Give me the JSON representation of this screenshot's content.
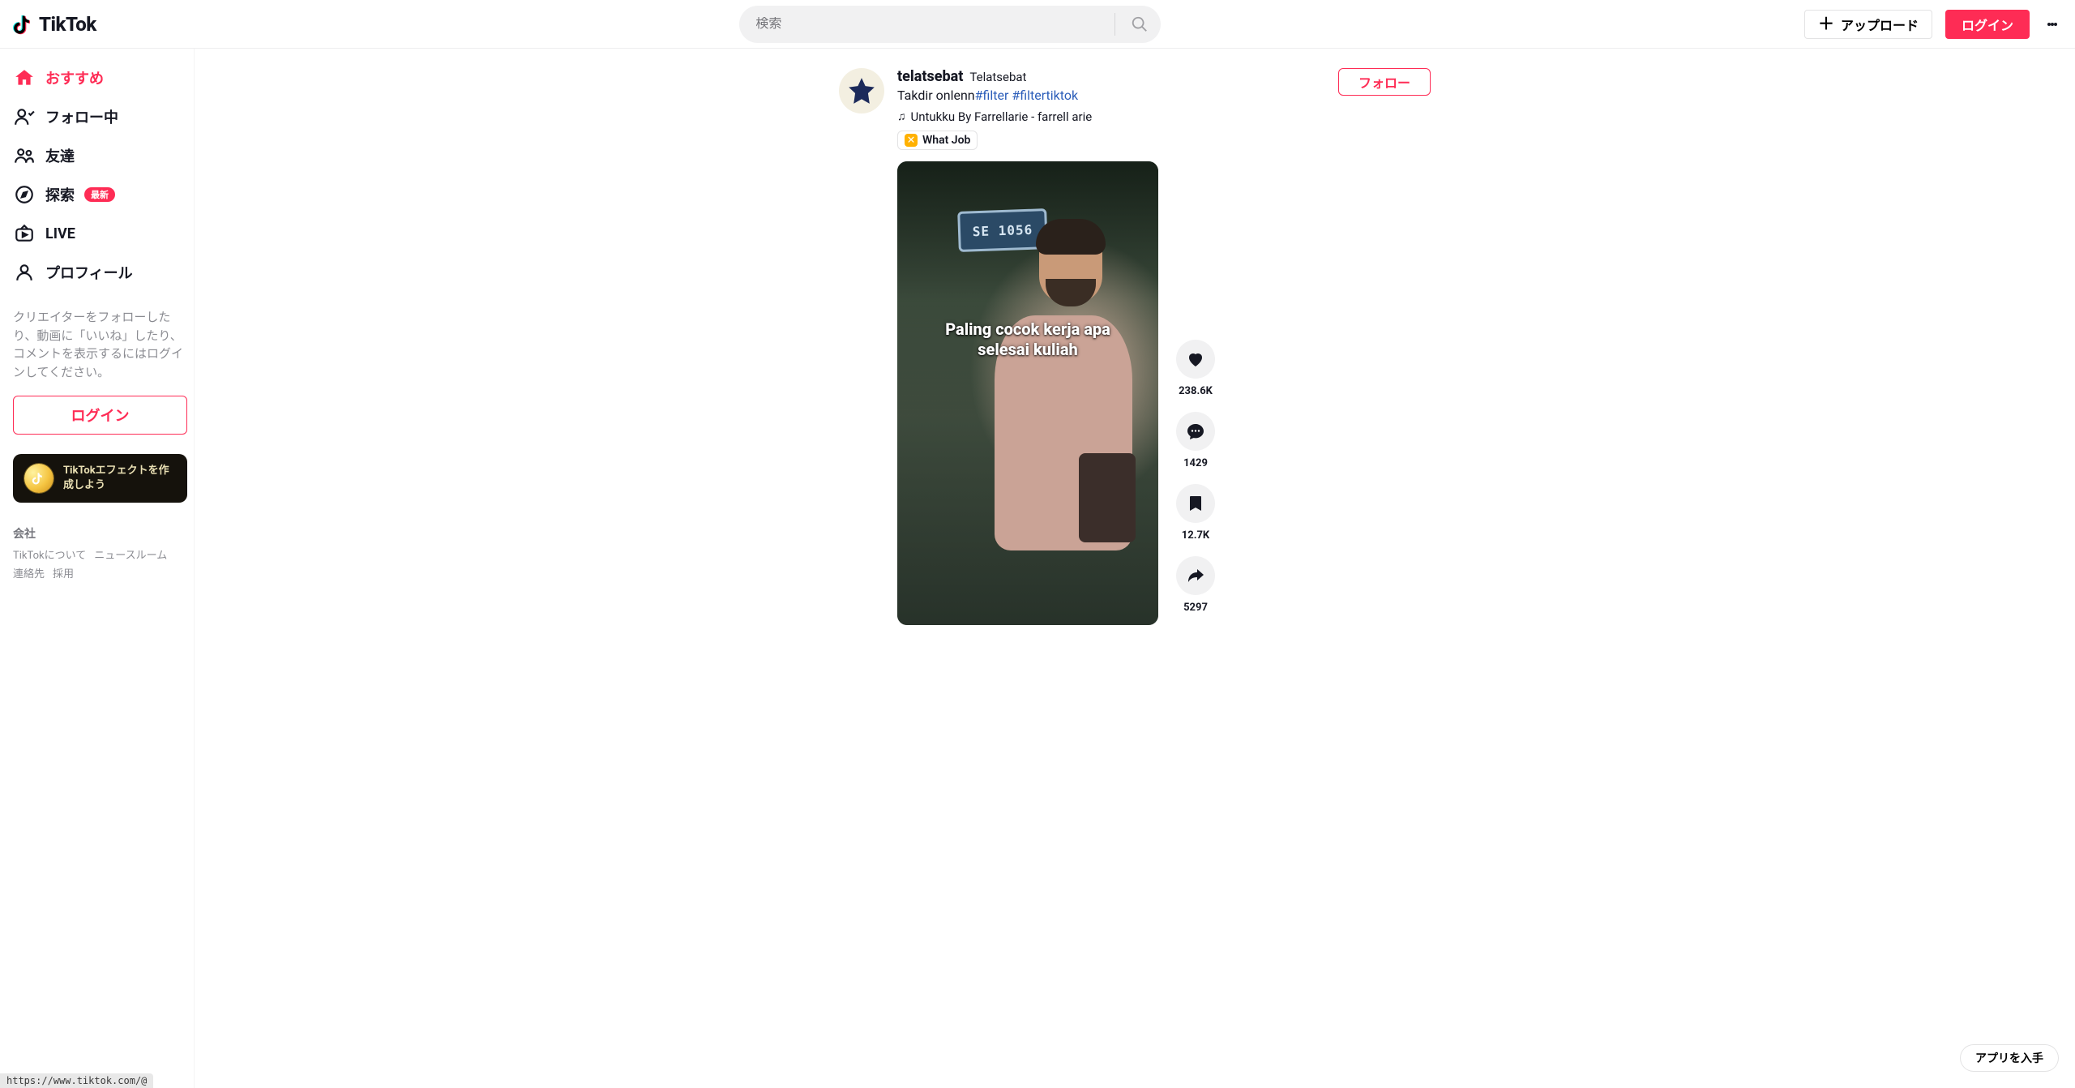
{
  "brand": "TikTok",
  "search": {
    "placeholder": "検索"
  },
  "header": {
    "upload": "アップロード",
    "login": "ログイン"
  },
  "sidebar": {
    "items": [
      {
        "label": "おすすめ",
        "icon": "home",
        "active": true
      },
      {
        "label": "フォロー中",
        "icon": "follow"
      },
      {
        "label": "友達",
        "icon": "friends"
      },
      {
        "label": "探索",
        "icon": "compass",
        "badge": "最新"
      },
      {
        "label": "LIVE",
        "icon": "live"
      },
      {
        "label": "プロフィール",
        "icon": "profile"
      }
    ],
    "hint": "クリエイターをフォローしたり、動画に「いいね」したり、コメントを表示するにはログインしてください。",
    "login": "ログイン",
    "effect_card": "TikTokエフェクトを作成しよう",
    "footer": {
      "title": "会社",
      "links1": [
        "TikTokについて",
        "ニュースルーム"
      ],
      "links2": [
        "連絡先",
        "採用"
      ]
    }
  },
  "post": {
    "username": "telatsebat",
    "displayname": "Telatsebat",
    "caption_text": "Takdir onlenn",
    "hashtags": [
      "#filter",
      "#filtertiktok"
    ],
    "music": "Untukku By Farrellarie - farrell arie",
    "effect_chip": "What Job",
    "follow": "フォロー",
    "video_text_line1": "Paling cocok kerja apa",
    "video_text_line2": "selesai kuliah",
    "plate_text": "SE 1056",
    "actions": {
      "likes": "238.6K",
      "comments": "1429",
      "saves": "12.7K",
      "shares": "5297"
    }
  },
  "get_app": "アプリを入手",
  "status_url": "https://www.tiktok.com/@"
}
